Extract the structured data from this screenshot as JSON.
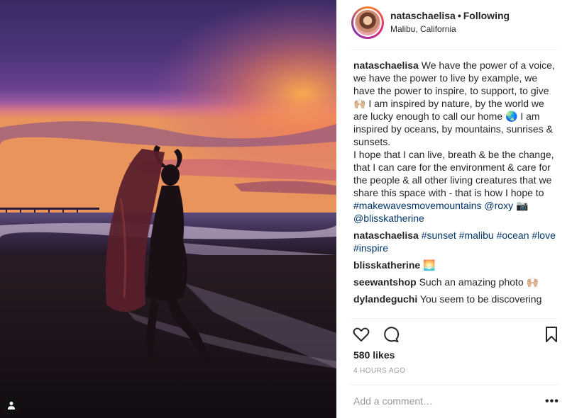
{
  "post": {
    "username": "nataschaelisa",
    "separator": "•",
    "follow_status": "Following",
    "location": "Malibu, California",
    "caption": {
      "username": "nataschaelisa",
      "text": " We have the power of a voice, we have the power to live by example, we have the power to inspire, to support, to give 🙌🏼 I am inspired by nature, by the world we are lucky enough to call our home 🌏 I am inspired by oceans, by mountains, sunrises & sunsets.\nI hope that I can live, breath & be the change, that I can care for the environment & care for the people & all other living creatures that we share this space with - that is how I hope to ",
      "hashtag": "#makewavesmovemountains",
      "mention1": "@roxy",
      "camera": " 📷 ",
      "mention2": "@blisskatherine"
    },
    "comments": [
      {
        "user": "nataschaelisa",
        "text": " ",
        "tags": "#sunset #malibu #ocean #love #inspire"
      },
      {
        "user": "blisskatherine",
        "text": " 🌅",
        "tags": ""
      },
      {
        "user": "seewantshop",
        "text": " Such an amazing photo 🙌🏼",
        "tags": ""
      },
      {
        "user": "dylandeguchi",
        "text": " You seem to be discovering",
        "tags": ""
      }
    ],
    "likes": "580 likes",
    "timestamp": "4 HOURS AGO",
    "comment_placeholder": "Add a comment…",
    "more_label": "•••"
  },
  "icons": {
    "like": "heart-icon",
    "comment": "speech-bubble-icon",
    "save": "bookmark-icon",
    "tag": "person-tag-icon"
  },
  "colors": {
    "text": "#262626",
    "link": "#003569",
    "muted": "#999999",
    "divider": "#efefef"
  }
}
